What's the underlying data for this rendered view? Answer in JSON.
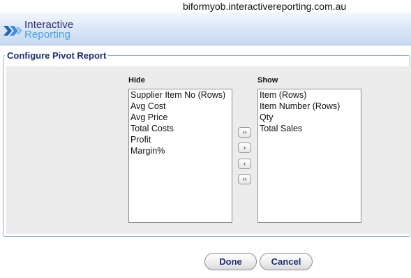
{
  "browser": {
    "url": "biformyob.interactivereporting.com.au"
  },
  "header": {
    "logo_line1": "Interactive",
    "logo_line2": "Reporting",
    "logo_icon": "double-chevron-arrow-icon"
  },
  "form": {
    "legend": "Configure Pivot Report",
    "hide": {
      "label": "Hide",
      "items": [
        "Supplier Item No (Rows)",
        "Avg Cost",
        "Avg Price",
        "Total Costs",
        "Profit",
        "Margin%"
      ]
    },
    "show": {
      "label": "Show",
      "items": [
        "Item (Rows)",
        "Item Number (Rows)",
        "Qty",
        "Total Sales"
      ]
    },
    "move_buttons": {
      "show_all": "››",
      "show_selected": "›",
      "hide_selected": "‹",
      "hide_all": "‹‹"
    },
    "actions": {
      "done": "Done",
      "cancel": "Cancel"
    }
  },
  "colors": {
    "header_gradient_top": "#f4f8fd",
    "header_gradient_bottom": "#c8d9f1",
    "legend_text": "#1c2f78",
    "logo_dark": "#2b2b6e",
    "logo_light": "#4aa3e6",
    "panel_bg": "#ececec"
  }
}
